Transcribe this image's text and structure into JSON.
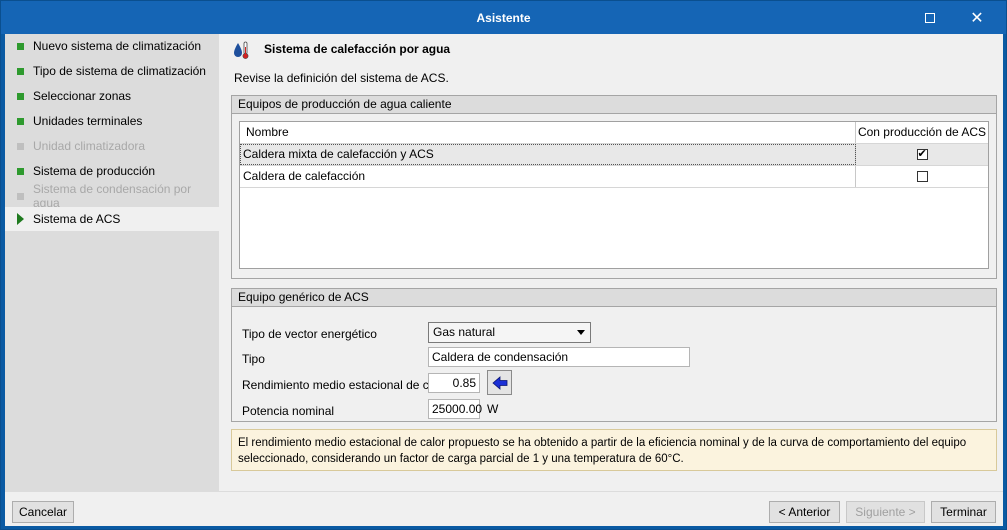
{
  "window": {
    "title": "Asistente"
  },
  "steps": [
    {
      "label": "Nuevo sistema de climatización",
      "state": "done"
    },
    {
      "label": "Tipo de sistema de climatización",
      "state": "done"
    },
    {
      "label": "Seleccionar zonas",
      "state": "done"
    },
    {
      "label": "Unidades terminales",
      "state": "done"
    },
    {
      "label": "Unidad climatizadora",
      "state": "disabled"
    },
    {
      "label": "Sistema de producción",
      "state": "done"
    },
    {
      "label": "Sistema de condensación por agua",
      "state": "disabled"
    },
    {
      "label": "Sistema de ACS",
      "state": "current"
    }
  ],
  "page": {
    "title": "Sistema de calefacción por agua",
    "subtitle": "Revise la definición del sistema de ACS."
  },
  "equipment_group": {
    "title": "Equipos de producción de agua caliente",
    "columns": [
      "Nombre",
      "Con producción de ACS"
    ],
    "rows": [
      {
        "name": "Caldera mixta de calefacción y ACS",
        "acs": true
      },
      {
        "name": "Caldera de calefacción",
        "acs": false
      }
    ]
  },
  "generic_group": {
    "title": "Equipo genérico de ACS",
    "vector_label": "Tipo de vector energético",
    "vector_value": "Gas natural",
    "tipo_label": "Tipo",
    "tipo_value": "Caldera de condensación",
    "rendimiento_label": "Rendimiento medio estacional de calor",
    "rendimiento_value": "0.85",
    "potencia_label": "Potencia nominal",
    "potencia_value": "25000.00",
    "potencia_unit": "W"
  },
  "note": "El rendimiento medio estacional de calor propuesto se ha obtenido a partir de la eficiencia nominal y de la curva de comportamiento del equipo seleccionado, considerando un factor de carga parcial de 1 y una temperatura de 60°C.",
  "footer": {
    "cancel": "Cancelar",
    "previous": "< Anterior",
    "next": "Siguiente >",
    "finish": "Terminar"
  },
  "colors": {
    "titlebar": "#1565b5",
    "step_done": "#2e9a2e",
    "note_bg": "#fbf3de"
  }
}
